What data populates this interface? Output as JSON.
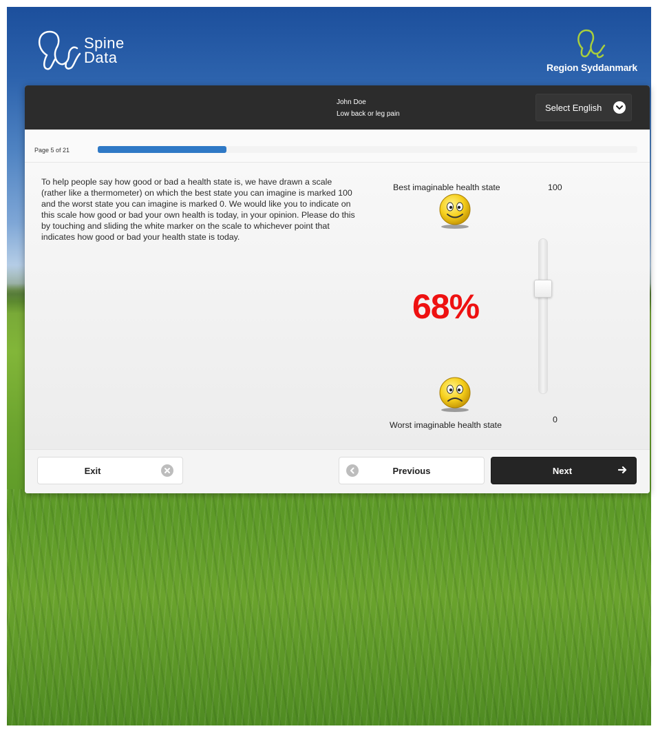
{
  "brand": {
    "left_logo_line1": "Spine",
    "left_logo_line2": "Data",
    "right_logo": "Region Syddanmark"
  },
  "header": {
    "patient_name": "John Doe",
    "diagnosis": "Low back or leg pain",
    "language_select": "Select English"
  },
  "progress": {
    "label": "Page 5 of 21",
    "current_page": 5,
    "total_pages": 21
  },
  "question": {
    "text": "To help people say how good or bad a health state is, we have drawn a scale (rather like a thermometer) on which the best state you can imagine is marked 100 and the worst state you can imagine is marked 0. We would like you to indicate on this scale how good or bad your own health is today, in your opinion. Please do this by touching and sliding the white marker on the scale to whichever point that indicates how good or bad your health state is today."
  },
  "scale": {
    "best_label": "Best imaginable health state",
    "best_value": "100",
    "worst_label": "Worst imaginable health state",
    "worst_value": "0",
    "current_display": "68%",
    "current_value": 68
  },
  "footer": {
    "exit_label": "Exit",
    "previous_label": "Previous",
    "next_label": "Next"
  },
  "colors": {
    "progress_fill": "#2f79c6",
    "percent_text": "#ee1111",
    "header_bg": "#2c2c2c",
    "next_button_bg": "#252525"
  },
  "icons": {
    "exit": "close-circle-icon",
    "previous": "arrow-left-circle-icon",
    "next": "arrow-right-icon",
    "language": "chevron-down-icon",
    "best": "happy-face-icon",
    "worst": "sad-face-icon"
  }
}
